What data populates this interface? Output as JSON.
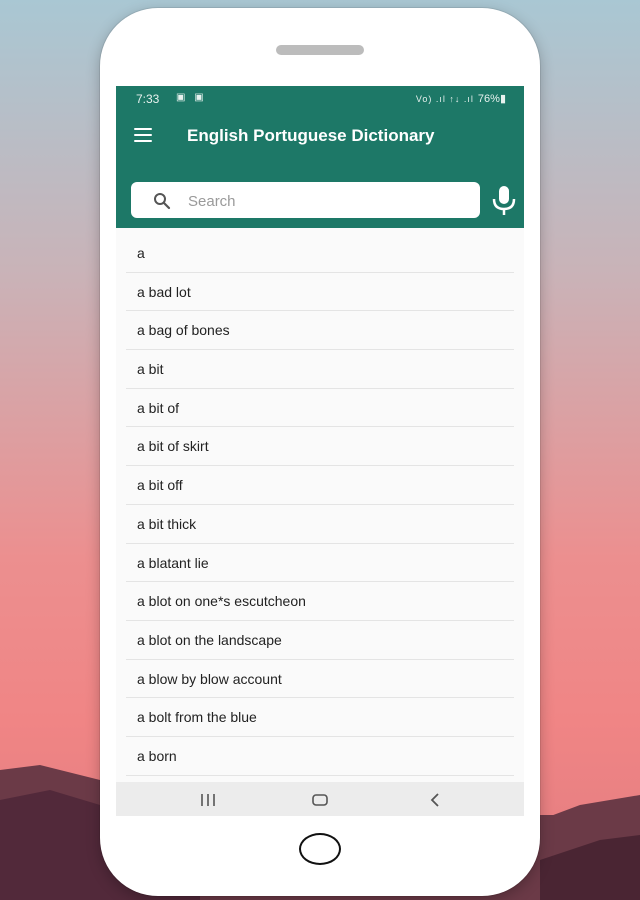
{
  "status_bar": {
    "time": "7:33",
    "notification_icons": "▣ ▣",
    "signal_text": "Vo) .ıl ↑↓ .ıl",
    "battery": "76%▮"
  },
  "app_bar": {
    "title": "English Portuguese Dictionary",
    "color": "#1d7867"
  },
  "search": {
    "placeholder": "Search",
    "value": ""
  },
  "word_list": [
    "a",
    "a bad lot",
    "a bag of bones",
    "a bit",
    "a bit of",
    "a bit of skirt",
    "a bit off",
    "a bit thick",
    "a blatant lie",
    "a blot on one*s escutcheon",
    "a blot on the landscape",
    "a blow by blow account",
    "a bolt from the blue",
    "a born"
  ],
  "nav_bar": {
    "icons": [
      "recents-icon",
      "home-icon",
      "back-icon"
    ]
  }
}
